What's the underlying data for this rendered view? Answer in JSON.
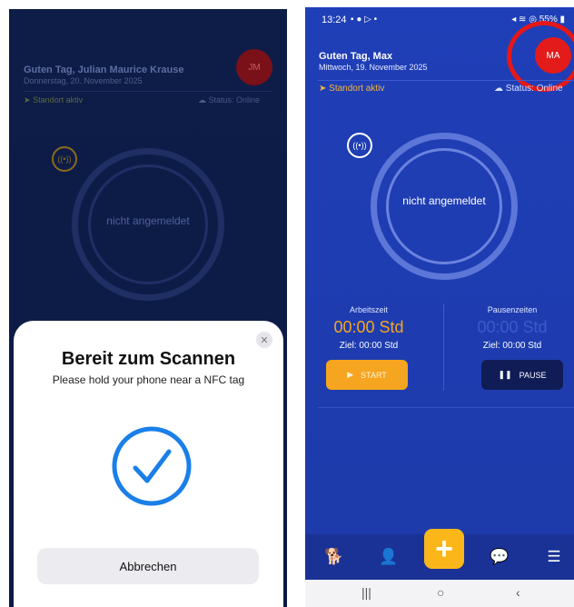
{
  "left": {
    "greeting": "Guten Tag, Julian Maurice Krause",
    "date": "Donnerstag, 20. November 2025",
    "avatar": "JM",
    "location": "Standort aktiv",
    "status": "Status: Online",
    "ring_label": "nicht angemeldet",
    "sheet": {
      "title": "Bereit zum Scannen",
      "subtitle": "Please hold your phone near a NFC tag",
      "cancel": "Abbrechen"
    }
  },
  "right": {
    "status_bar": {
      "time": "13:24",
      "icons": "▪ ● ▷ •",
      "right": "◂ ≋ ◎ 55% ▮"
    },
    "greeting": "Guten Tag, Max",
    "date": "Mittwoch, 19. November 2025",
    "avatar": "MA",
    "location": "Standort aktiv",
    "status": "Status: Online",
    "ring_label": "nicht angemeldet",
    "work": {
      "label": "Arbeitszeit",
      "time": "00:00 Std",
      "goal": "Ziel: 00:00 Std",
      "button": "START"
    },
    "pause": {
      "label": "Pausenzeiten",
      "time": "00:00 Std",
      "goal": "Ziel: 00:00 Std",
      "button": "PAUSE"
    },
    "nav": {
      "add": "+"
    },
    "android_nav": {
      "recent": "|||",
      "home": "○",
      "back": "‹"
    }
  },
  "colors": {
    "left_bg": "#0e1d48",
    "right_bg": "#1f3fb8",
    "accent_orange": "#f6a520",
    "avatar_red": "#e31b1b",
    "check_blue": "#1a7fe8"
  }
}
